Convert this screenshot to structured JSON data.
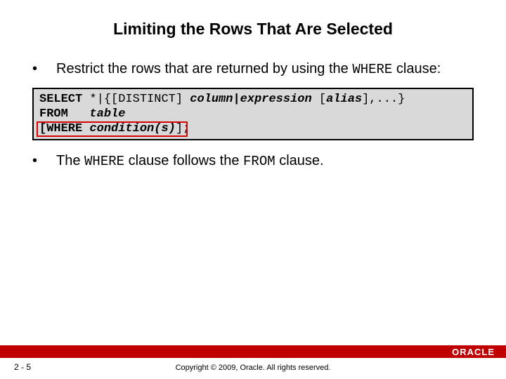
{
  "title": "Limiting the Rows That Are Selected",
  "bullets": [
    {
      "pre": "Restrict the rows that are returned by using the ",
      "code": "WHERE",
      "post": " clause:"
    },
    {
      "pre": "The ",
      "code": "WHERE",
      "mid": " clause follows the ",
      "code2": "FROM",
      "post": " clause."
    }
  ],
  "code": {
    "line1": {
      "kw": "SELECT",
      "pad": " ",
      "plain": "*|{[DISTINCT] ",
      "it": "column|expression ",
      "plain2": "[",
      "it2": "alias",
      "plain3": "],...}"
    },
    "line2": {
      "kw": "FROM",
      "pad": "   ",
      "it": "table"
    },
    "line3": {
      "kw": "[WHERE",
      "pad": " ",
      "it": "condition(s)",
      "plain": "];"
    }
  },
  "footer": {
    "page": "2 - 5",
    "copyright": "Copyright © 2009, Oracle. All rights reserved.",
    "logo": "ORACLE"
  }
}
